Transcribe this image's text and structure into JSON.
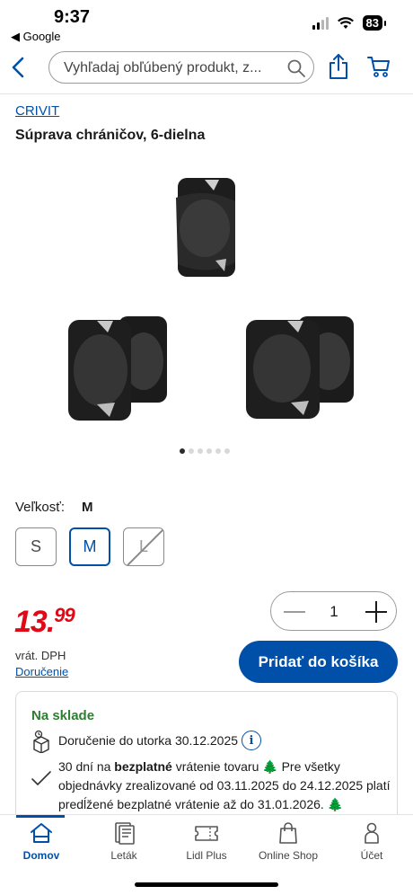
{
  "status_bar": {
    "time": "9:37",
    "back_app": "◀ Google",
    "battery": "83"
  },
  "header": {
    "search_placeholder": "Vyhľadaj obľúbený produkt, z..."
  },
  "product": {
    "brand": "CRIVIT",
    "title": "Súprava chráničov, 6-dielna",
    "gallery": {
      "image_count": 6,
      "active_index": 0
    }
  },
  "size": {
    "label": "Veľkosť:",
    "selected": "M",
    "options": [
      {
        "label": "S",
        "state": "available"
      },
      {
        "label": "M",
        "state": "selected"
      },
      {
        "label": "L",
        "state": "unavailable"
      }
    ]
  },
  "price": {
    "main": "13.",
    "cents": "99",
    "vat": "vrát. DPH",
    "delivery_link": "Doručenie",
    "color": "#e10915"
  },
  "quantity": {
    "value": "1"
  },
  "cart": {
    "add_label": "Pridať do košíka",
    "accent": "#0050aa"
  },
  "stock": {
    "status": "Na sklade",
    "status_color": "#2e7d32",
    "delivery": "Doručenie do utorka 30.12.2025",
    "return_prefix": "30 dní na ",
    "return_bold": "bezplatné",
    "return_middle": " vrátenie tovaru ",
    "return_rest": " Pre všetky objednávky zrealizované od 03.11.2025 do 24.12.2025 platí predĺžené bezplatné vrátenie až do 31.01.2026. ",
    "tree_glyph": "🌲"
  },
  "nav": {
    "items": [
      {
        "label": "Domov",
        "icon": "home-icon",
        "active": true
      },
      {
        "label": "Leták",
        "icon": "leaflet-icon",
        "active": false
      },
      {
        "label": "Lidl Plus",
        "icon": "coupon-icon",
        "active": false
      },
      {
        "label": "Online Shop",
        "icon": "bag-icon",
        "active": false
      },
      {
        "label": "Účet",
        "icon": "account-icon",
        "active": false
      }
    ]
  }
}
